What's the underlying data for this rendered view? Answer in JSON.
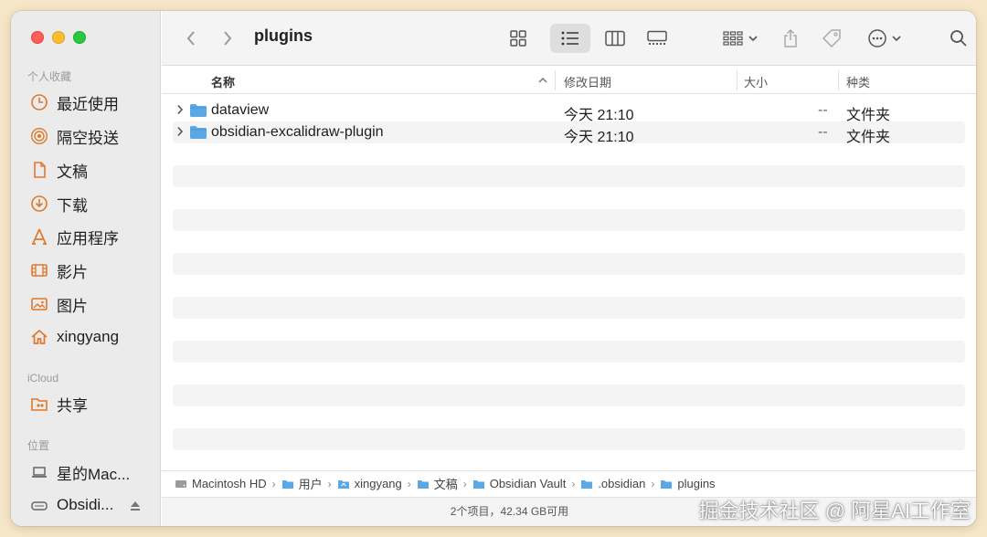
{
  "window": {
    "title": "plugins"
  },
  "sidebar": {
    "favorites_header": "个人收藏",
    "favorites": [
      {
        "label": "最近使用",
        "icon": "clock-icon"
      },
      {
        "label": "隔空投送",
        "icon": "airdrop-icon"
      },
      {
        "label": "文稿",
        "icon": "document-icon"
      },
      {
        "label": "下载",
        "icon": "download-icon"
      },
      {
        "label": "应用程序",
        "icon": "applications-icon"
      },
      {
        "label": "影片",
        "icon": "film-icon"
      },
      {
        "label": "图片",
        "icon": "photo-icon"
      },
      {
        "label": "xingyang",
        "icon": "home-icon"
      }
    ],
    "icloud_header": "iCloud",
    "icloud": [
      {
        "label": "共享",
        "icon": "shared-folder-icon"
      }
    ],
    "locations_header": "位置",
    "locations": [
      {
        "label": "星的Mac...",
        "icon": "laptop-icon"
      },
      {
        "label": "Obsidi...",
        "icon": "drive-icon"
      }
    ]
  },
  "columns": {
    "name": "名称",
    "modified": "修改日期",
    "size": "大小",
    "kind": "种类"
  },
  "files": [
    {
      "name": "dataview",
      "modified": "今天 21:10",
      "size": "--",
      "kind": "文件夹"
    },
    {
      "name": "obsidian-excalidraw-plugin",
      "modified": "今天 21:10",
      "size": "--",
      "kind": "文件夹"
    }
  ],
  "path": [
    {
      "label": "Macintosh HD",
      "icon": "hard-drive-icon"
    },
    {
      "label": "用户",
      "icon": "folder-icon"
    },
    {
      "label": "xingyang",
      "icon": "home-folder-icon"
    },
    {
      "label": "文稿",
      "icon": "folder-icon"
    },
    {
      "label": "Obsidian Vault",
      "icon": "folder-icon"
    },
    {
      "label": ".obsidian",
      "icon": "folder-icon"
    },
    {
      "label": "plugins",
      "icon": "folder-icon"
    }
  ],
  "status": {
    "text": "2个项目，42.34 GB可用"
  },
  "watermark": "掘金技术社区 @ 阿星AI工作室",
  "colors": {
    "accent_folder": "#5aa9e6",
    "sidebar_bg": "#ebebeb",
    "sidebar_icon": "#e0782b"
  }
}
